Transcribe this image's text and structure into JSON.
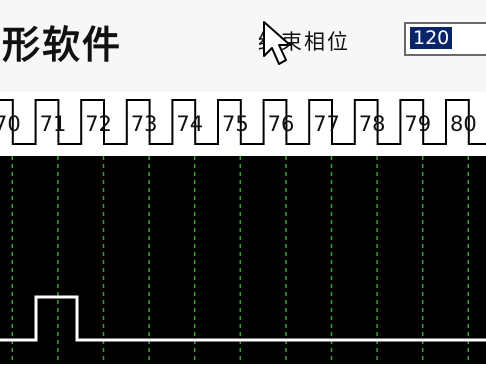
{
  "app": {
    "title": "形软件"
  },
  "end_phase": {
    "label": "结束相位",
    "value": "120"
  },
  "clock_ticks": [
    "70",
    "71",
    "72",
    "73",
    "74",
    "75",
    "76",
    "77",
    "78",
    "79",
    "80"
  ],
  "colors": {
    "background": "#ffffff",
    "scope_background": "#000000",
    "grid_line": "#2ea52e",
    "trace": "#ffffff",
    "selection": "#0a246a"
  },
  "icons": {
    "cursor": "arrow-cursor-icon"
  }
}
